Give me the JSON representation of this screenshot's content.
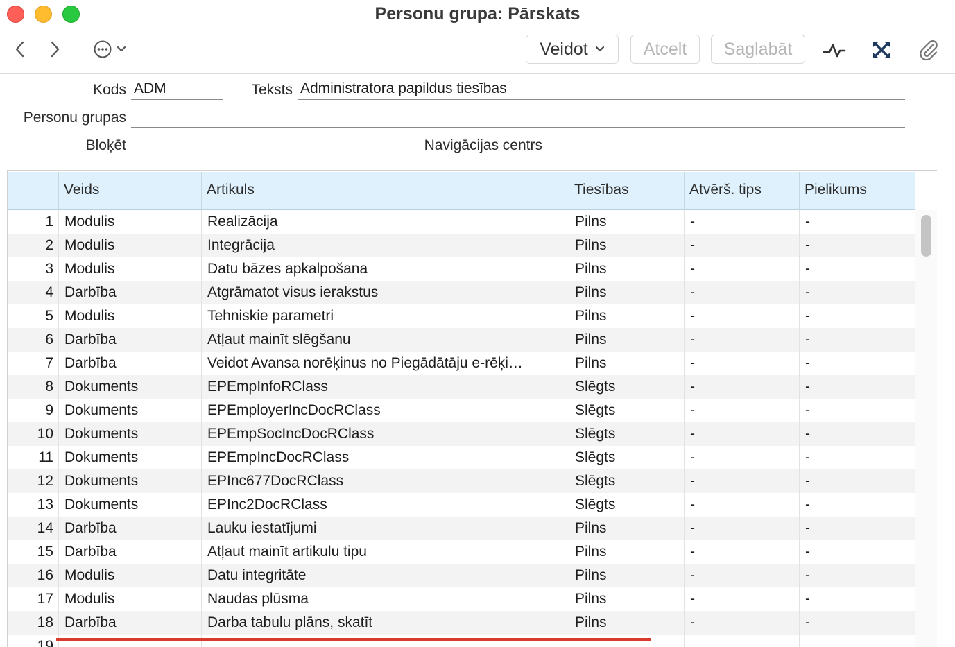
{
  "window": {
    "title": "Personu grupa: Pārskats"
  },
  "toolbar": {
    "veidot_label": "Veidot",
    "atcelt_label": "Atcelt",
    "saglabat_label": "Saglabāt"
  },
  "form": {
    "kods_label": "Kods",
    "kods_value": "ADM",
    "teksts_label": "Teksts",
    "teksts_value": "Administratora papildus tiesības",
    "personu_grupas_label": "Personu grupas",
    "personu_grupas_value": "",
    "bloket_label": "Bloķēt",
    "bloket_value": "",
    "navigacijas_label": "Navigācijas centrs",
    "navigacijas_value": ""
  },
  "grid": {
    "columns": [
      "",
      "Veids",
      "Artikuls",
      "Tiesības",
      "Atvērš. tips",
      "Pielikums"
    ],
    "rows": [
      {
        "n": "1",
        "veids": "Modulis",
        "artikuls": "Realizācija",
        "tiesibas": "Pilns",
        "tips": "-",
        "pielikums": "-"
      },
      {
        "n": "2",
        "veids": "Modulis",
        "artikuls": "Integrācija",
        "tiesibas": "Pilns",
        "tips": "-",
        "pielikums": "-"
      },
      {
        "n": "3",
        "veids": "Modulis",
        "artikuls": "Datu bāzes apkalpošana",
        "tiesibas": "Pilns",
        "tips": "-",
        "pielikums": "-"
      },
      {
        "n": "4",
        "veids": "Darbība",
        "artikuls": "Atgrāmatot visus ierakstus",
        "tiesibas": "Pilns",
        "tips": "-",
        "pielikums": "-"
      },
      {
        "n": "5",
        "veids": "Modulis",
        "artikuls": "Tehniskie parametri",
        "tiesibas": "Pilns",
        "tips": "-",
        "pielikums": "-"
      },
      {
        "n": "6",
        "veids": "Darbība",
        "artikuls": "Atļaut mainīt slēgšanu",
        "tiesibas": "Pilns",
        "tips": "-",
        "pielikums": "-"
      },
      {
        "n": "7",
        "veids": "Darbība",
        "artikuls": "Veidot Avansa norēķinus no Piegādātāju e-rēķi…",
        "tiesibas": "Pilns",
        "tips": "-",
        "pielikums": "-"
      },
      {
        "n": "8",
        "veids": "Dokuments",
        "artikuls": "EPEmpInfoRClass",
        "tiesibas": "Slēgts",
        "tips": "-",
        "pielikums": "-"
      },
      {
        "n": "9",
        "veids": "Dokuments",
        "artikuls": "EPEmployerIncDocRClass",
        "tiesibas": "Slēgts",
        "tips": "-",
        "pielikums": "-"
      },
      {
        "n": "10",
        "veids": "Dokuments",
        "artikuls": "EPEmpSocIncDocRClass",
        "tiesibas": "Slēgts",
        "tips": "-",
        "pielikums": "-"
      },
      {
        "n": "11",
        "veids": "Dokuments",
        "artikuls": "EPEmpIncDocRClass",
        "tiesibas": "Slēgts",
        "tips": "-",
        "pielikums": "-"
      },
      {
        "n": "12",
        "veids": "Dokuments",
        "artikuls": "EPInc677DocRClass",
        "tiesibas": "Slēgts",
        "tips": "-",
        "pielikums": "-"
      },
      {
        "n": "13",
        "veids": "Dokuments",
        "artikuls": "EPInc2DocRClass",
        "tiesibas": "Slēgts",
        "tips": "-",
        "pielikums": "-"
      },
      {
        "n": "14",
        "veids": "Darbība",
        "artikuls": "Lauku iestatījumi",
        "tiesibas": "Pilns",
        "tips": "-",
        "pielikums": "-"
      },
      {
        "n": "15",
        "veids": "Darbība",
        "artikuls": "Atļaut mainīt artikulu tipu",
        "tiesibas": "Pilns",
        "tips": "-",
        "pielikums": "-"
      },
      {
        "n": "16",
        "veids": "Modulis",
        "artikuls": "Datu integritāte",
        "tiesibas": "Pilns",
        "tips": "-",
        "pielikums": "-"
      },
      {
        "n": "17",
        "veids": "Modulis",
        "artikuls": "Naudas plūsma",
        "tiesibas": "Pilns",
        "tips": "-",
        "pielikums": "-"
      },
      {
        "n": "18",
        "veids": "Darbība",
        "artikuls": "Darba tabulu plāns, skatīt",
        "tiesibas": "Pilns",
        "tips": "-",
        "pielikums": "-"
      },
      {
        "n": "19",
        "veids": "",
        "artikuls": "",
        "tiesibas": "",
        "tips": "",
        "pielikums": ""
      }
    ]
  }
}
